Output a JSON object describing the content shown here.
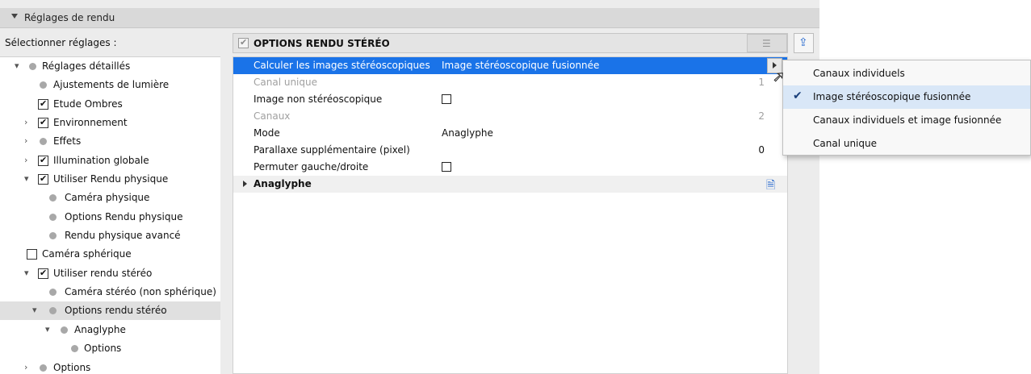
{
  "panel": {
    "title": "Réglages de rendu",
    "select_label": "Sélectionner réglages :"
  },
  "tree": [
    {
      "label": "Réglages détaillés",
      "expand": "open",
      "marker": "dot"
    },
    {
      "label": "Ajustements de lumière",
      "expand": "none",
      "marker": "dot"
    },
    {
      "label": "Etude Ombres",
      "expand": "none",
      "marker": "checked"
    },
    {
      "label": "Environnement",
      "expand": "closed",
      "marker": "checked"
    },
    {
      "label": "Effets",
      "expand": "closed",
      "marker": "dot"
    },
    {
      "label": "Illumination globale",
      "expand": "closed",
      "marker": "checked"
    },
    {
      "label": "Utiliser Rendu physique",
      "expand": "open",
      "marker": "checked"
    },
    {
      "label": "Caméra physique",
      "expand": "none",
      "marker": "dot"
    },
    {
      "label": "Options Rendu physique",
      "expand": "none",
      "marker": "dot"
    },
    {
      "label": "Rendu physique avancé",
      "expand": "none",
      "marker": "dot"
    },
    {
      "label": "Caméra sphérique",
      "expand": "none",
      "marker": "unchecked"
    },
    {
      "label": "Utiliser rendu stéréo",
      "expand": "open",
      "marker": "checked"
    },
    {
      "label": "Caméra stéréo (non sphérique)",
      "expand": "none",
      "marker": "dot"
    },
    {
      "label": "Options rendu stéréo",
      "expand": "open",
      "marker": "dot",
      "selected": true
    },
    {
      "label": "Anaglyphe",
      "expand": "open",
      "marker": "dot"
    },
    {
      "label": "Options",
      "expand": "none",
      "marker": "dot"
    },
    {
      "label": "Options",
      "expand": "closed",
      "marker": "dot"
    }
  ],
  "options": {
    "header_title": "OPTIONS RENDU STÉRÉO",
    "rows": {
      "calc": {
        "label": "Calculer les images stéréoscopiques",
        "value": "Image stéréoscopique fusionnée"
      },
      "single_channel": {
        "label": "Canal unique",
        "value": "1"
      },
      "non_stereo": {
        "label": "Image non stéréoscopique",
        "checked": false
      },
      "channels": {
        "label": "Canaux",
        "value": "2"
      },
      "mode": {
        "label": "Mode",
        "value": "Anaglyphe"
      },
      "parallax": {
        "label": "Parallaxe supplémentaire (pixel)",
        "value": "0"
      },
      "swap": {
        "label": "Permuter gauche/droite",
        "checked": false
      },
      "anaglyph_group": {
        "label": "Anaglyphe"
      }
    }
  },
  "dropdown": {
    "items": [
      {
        "label": "Canaux individuels",
        "checked": false
      },
      {
        "label": "Image stéréoscopique fusionnée",
        "checked": true
      },
      {
        "label": "Canaux individuels et image fusionnée",
        "checked": false
      },
      {
        "label": "Canal unique",
        "checked": false
      }
    ]
  },
  "colors": {
    "accent": "#1a73e8",
    "selection_bg": "#e0e0e0"
  },
  "icons": [
    "list-icon",
    "export-icon",
    "settings-doc-icon",
    "checkmark-icon",
    "cursor-icon"
  ]
}
